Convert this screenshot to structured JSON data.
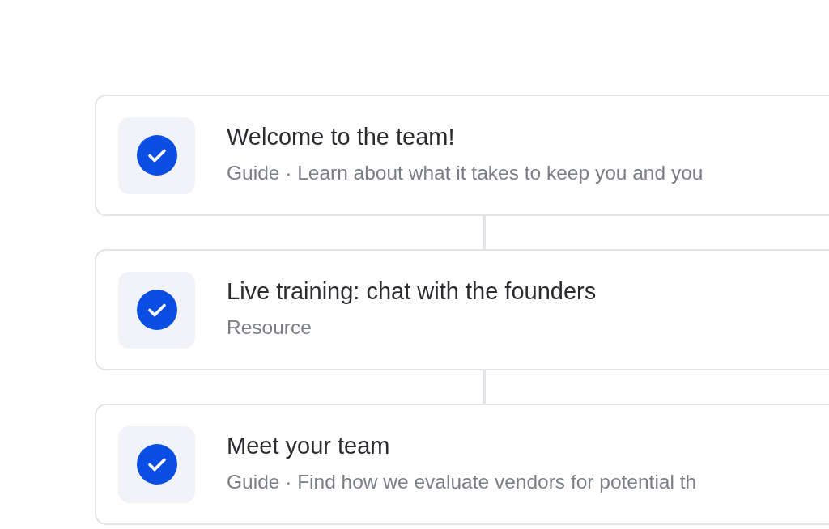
{
  "steps": [
    {
      "title": "Welcome to the team!",
      "subtitle": "Guide · Learn about what it takes to keep you and you",
      "done": true
    },
    {
      "title": "Live training: chat with the founders",
      "subtitle": "Resource",
      "done": true
    },
    {
      "title": "Meet your team",
      "subtitle": "Guide · Find how we evaluate vendors for potential th",
      "done": true
    }
  ]
}
